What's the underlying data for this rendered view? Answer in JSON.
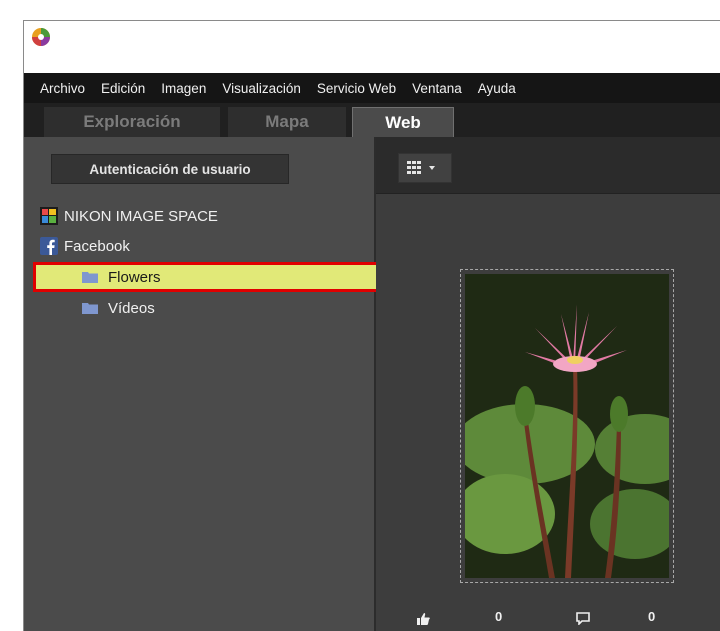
{
  "menu": [
    "Archivo",
    "Edición",
    "Imagen",
    "Visualización",
    "Servicio Web",
    "Ventana",
    "Ayuda"
  ],
  "tabs": [
    {
      "label": "Exploración",
      "active": false
    },
    {
      "label": "Mapa",
      "active": false
    },
    {
      "label": "Web",
      "active": true
    }
  ],
  "sidebar": {
    "auth_button": "Autenticación de usuario",
    "services": [
      {
        "label": "NIKON IMAGE SPACE",
        "icon": "nikon-image-space-icon"
      },
      {
        "label": "Facebook",
        "icon": "facebook-icon"
      }
    ],
    "albums": [
      {
        "label": "Flowers",
        "icon": "folder-icon",
        "selected": true
      },
      {
        "label": "Vídeos",
        "icon": "folder-icon",
        "selected": false
      }
    ]
  },
  "content": {
    "view_button_icon": "grid-view-icon",
    "photo": {
      "subject": "pink water lily"
    },
    "likes": "0",
    "comments": "0"
  },
  "colors": {
    "selection": "#e1e978",
    "selection_border": "#e00000",
    "menubar": "#151515"
  }
}
